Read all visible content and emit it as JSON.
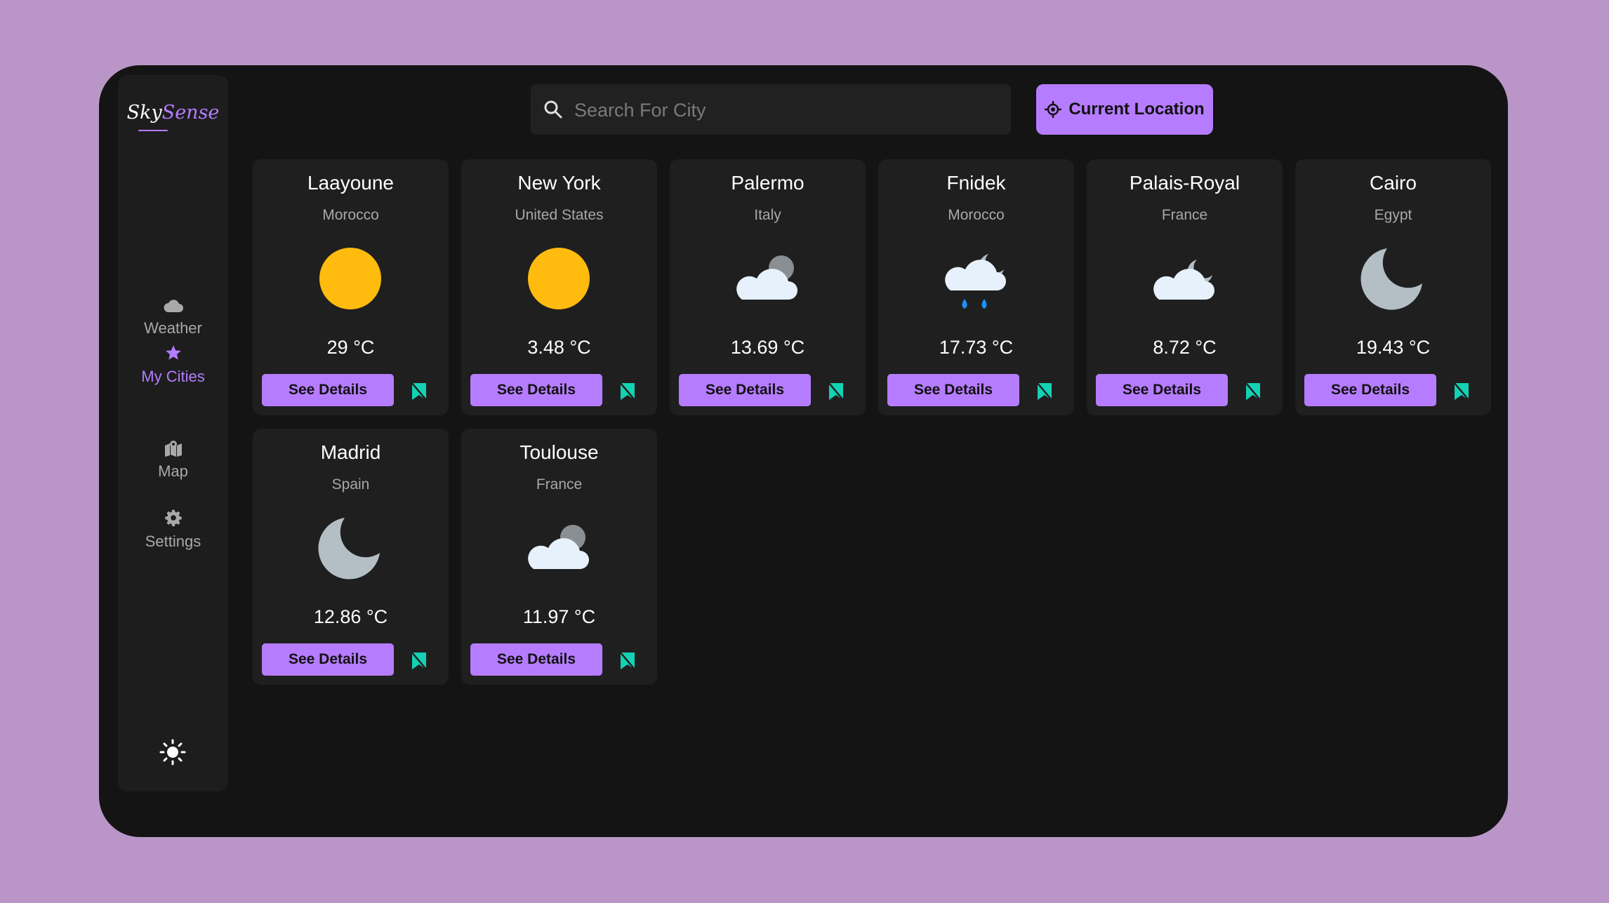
{
  "app": {
    "logo_part1": "Sky",
    "logo_part2": "Sense"
  },
  "sidebar": {
    "items": [
      {
        "label": "Weather",
        "icon": "cloud-icon",
        "active": false
      },
      {
        "label": "My Cities",
        "icon": "star-icon",
        "active": true
      },
      {
        "label": "Map",
        "icon": "map-icon",
        "active": false
      },
      {
        "label": "Settings",
        "icon": "gear-icon",
        "active": false
      }
    ],
    "theme_icon": "sun-icon"
  },
  "search": {
    "placeholder": "Search For City",
    "value": ""
  },
  "location_button": {
    "label": "Current Location",
    "icon": "crosshair-icon"
  },
  "cards": [
    {
      "city": "Laayoune",
      "country": "Morocco",
      "temp": "29 °C",
      "icon": "sun-icon",
      "button": "See Details",
      "bookmark": "bookmark-icon"
    },
    {
      "city": "New York",
      "country": "United States",
      "temp": "3.48 °C",
      "icon": "sun-icon",
      "button": "See Details",
      "bookmark": "bookmark-icon"
    },
    {
      "city": "Palermo",
      "country": "Italy",
      "temp": "13.69 °C",
      "icon": "cloud-night-icon",
      "button": "See Details",
      "bookmark": "bookmark-icon"
    },
    {
      "city": "Fnidek",
      "country": "Morocco",
      "temp": "17.73 °C",
      "icon": "rain-night-icon",
      "button": "See Details",
      "bookmark": "bookmark-icon"
    },
    {
      "city": "Palais-Royal",
      "country": "France",
      "temp": "8.72 °C",
      "icon": "cloud-moon-icon",
      "button": "See Details",
      "bookmark": "bookmark-icon"
    },
    {
      "city": "Cairo",
      "country": "Egypt",
      "temp": "19.43 °C",
      "icon": "moon-icon",
      "button": "See Details",
      "bookmark": "bookmark-icon"
    },
    {
      "city": "Madrid",
      "country": "Spain",
      "temp": "12.86 °C",
      "icon": "moon-icon",
      "button": "See Details",
      "bookmark": "bookmark-icon"
    },
    {
      "city": "Toulouse",
      "country": "France",
      "temp": "11.97 °C",
      "icon": "cloud-night-icon",
      "button": "See Details",
      "bookmark": "bookmark-icon"
    }
  ],
  "colors": {
    "accent": "#b67cff",
    "bookmark": "#14d1b4",
    "sun": "#ffbb0e",
    "cloud": "#e6f1fb",
    "moon": "#b3bfc5",
    "rain": "#1e90ff"
  }
}
